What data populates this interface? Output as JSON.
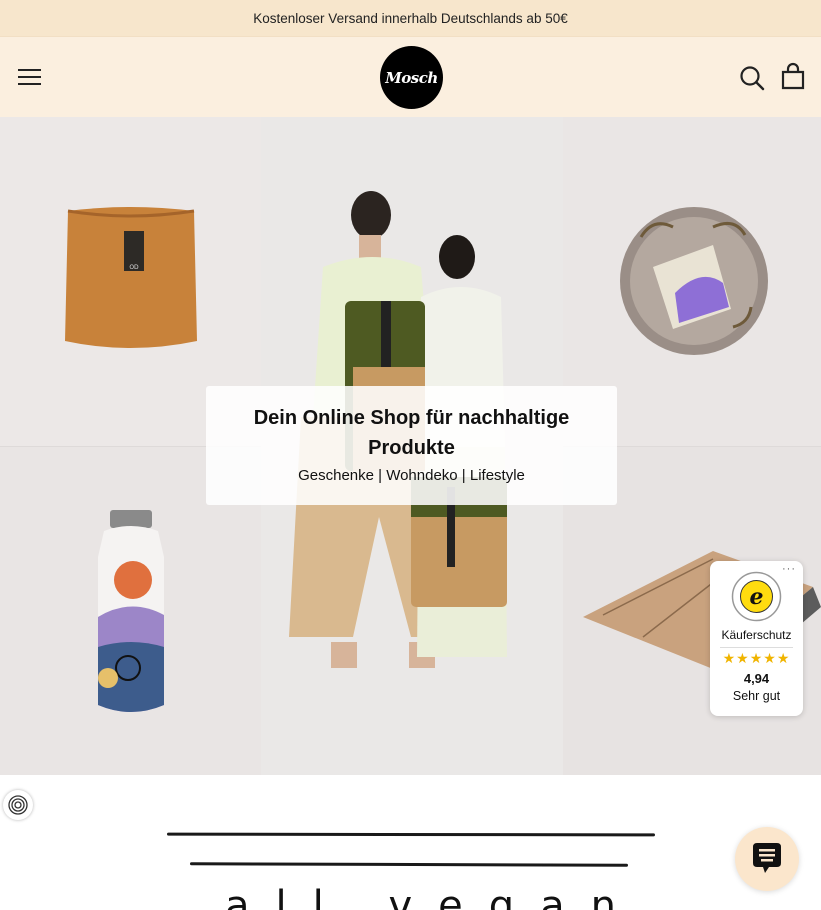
{
  "announcement": "Kostenloser Versand innerhalb Deutschlands ab 50€",
  "header": {
    "logo_text": "Mosch",
    "menu_icon": "hamburger-icon",
    "search_icon": "search-icon",
    "cart_icon": "cart-icon"
  },
  "hero": {
    "title": "Dein Online Shop für nachhaltige Produkte",
    "subtitle": "Geschenke | Wohndeko | Lifestyle",
    "tiles": [
      "paper-planter-image",
      "soap-dish-image",
      "backpack-models-image",
      "water-bottle-image",
      "yoga-mat-image"
    ]
  },
  "trusted_shops": {
    "label": "Käuferschutz",
    "stars": "★★★★★",
    "score": "4,94",
    "verdict": "Sehr gut",
    "more": "···"
  },
  "colors": {
    "announcement_bg": "#f7e6cc",
    "header_bg": "#fbefdf",
    "star": "#f0b400"
  },
  "section": {
    "headline": "all vegan"
  }
}
